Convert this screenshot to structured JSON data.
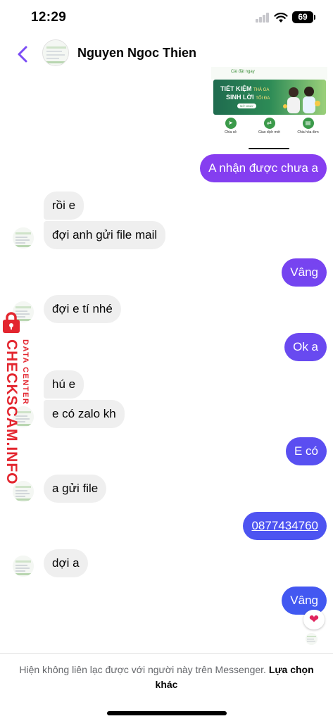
{
  "status_bar": {
    "time": "12:29",
    "battery": "69"
  },
  "header": {
    "contact_name": "Nguyen Ngoc Thien",
    "back_icon": "chevron-left-icon"
  },
  "shared_image": {
    "top_text": "Cài đặt ngay",
    "banner_line1": "TIẾT KIỆM",
    "banner_line1_small": "THẢ GA",
    "banner_line2": "SINH LỜI",
    "banner_line2_small": "TỐI ĐA",
    "banner_cta": "MỞ NGAY",
    "icons": [
      {
        "icon": "send-icon",
        "label": "Chia sẻ"
      },
      {
        "icon": "transfer-icon",
        "label": "Giao dịch mới"
      },
      {
        "icon": "receipt-icon",
        "label": "Chia hóa đơn"
      }
    ]
  },
  "messages": [
    {
      "side": "out",
      "text": "A nhận được chưa a"
    },
    {
      "side": "in",
      "text": "rồi e"
    },
    {
      "side": "in",
      "text": "đợi anh gửi file mail"
    },
    {
      "side": "out",
      "text": "Vâng"
    },
    {
      "side": "in",
      "text": "đợi e tí nhé"
    },
    {
      "side": "out",
      "text": "Ok a"
    },
    {
      "side": "in",
      "text": "hú e"
    },
    {
      "side": "in",
      "text": "e có zalo kh"
    },
    {
      "side": "out",
      "text": "E có"
    },
    {
      "side": "in",
      "text": "a gửi file"
    },
    {
      "side": "out",
      "text": "0877434760"
    },
    {
      "side": "in",
      "text": "dợi a"
    },
    {
      "side": "out",
      "text": "Vâng"
    }
  ],
  "reaction": {
    "icon": "heart-icon",
    "glyph": "❤"
  },
  "watermark": {
    "brand": "CHECKSCAM.INFO",
    "subtitle": "DATA CENTER"
  },
  "footer": {
    "notice": "Hiện không liên lạc được với người này trên Messenger.",
    "link": "Lựa chọn khác"
  },
  "colors": {
    "accent": "#7b4cf5",
    "bubble_out_top": "#8a3cf0",
    "bubble_out_bottom": "#3d5af1",
    "bubble_in": "#efefef",
    "watermark_red": "#e3262f"
  }
}
